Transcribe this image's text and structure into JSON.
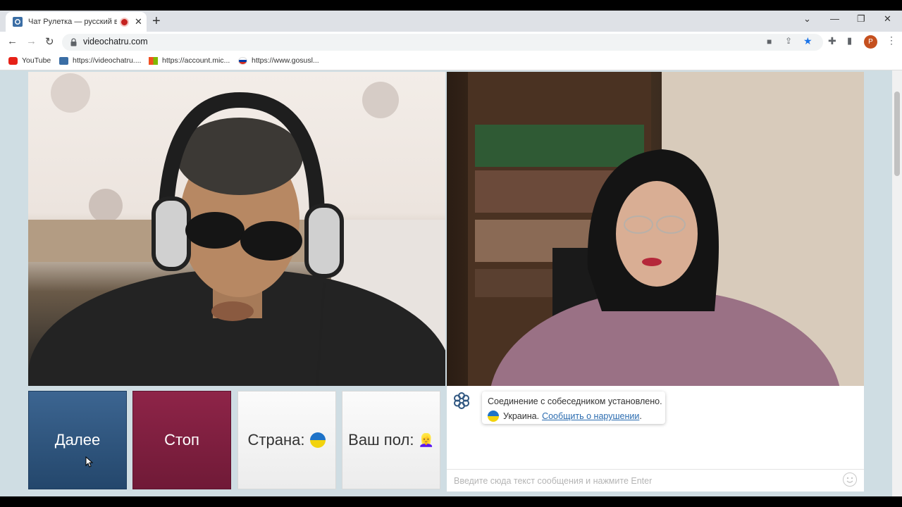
{
  "browser": {
    "tab_title": "Чат Рулетка — русский вид",
    "url": "videochatru.com",
    "profile_initial": "P",
    "bookmarks": [
      {
        "label": "YouTube"
      },
      {
        "label": "https://videochatru...."
      },
      {
        "label": "https://account.mic..."
      },
      {
        "label": "https://www.gosusl..."
      }
    ]
  },
  "controls": {
    "next_label": "Далее",
    "stop_label": "Стоп",
    "country_label": "Страна:",
    "gender_label": "Ваш пол:",
    "gender_emoji": "👱‍♀️"
  },
  "chat": {
    "message_connected": "Соединение с собеседником установлено.",
    "country_name": "Украина.",
    "report_link": "Сообщить о нарушении",
    "report_suffix": ".",
    "input_placeholder": "Введите сюда текст сообщения и нажмите Enter"
  },
  "colors": {
    "next_button": "#2f5680",
    "stop_button": "#7d1f40",
    "page_background": "#cfdde3",
    "link": "#2b6cb0"
  },
  "icons": {
    "site_logo": "atom-flower-icon",
    "country_flag": "ukraine-flag-icon"
  }
}
